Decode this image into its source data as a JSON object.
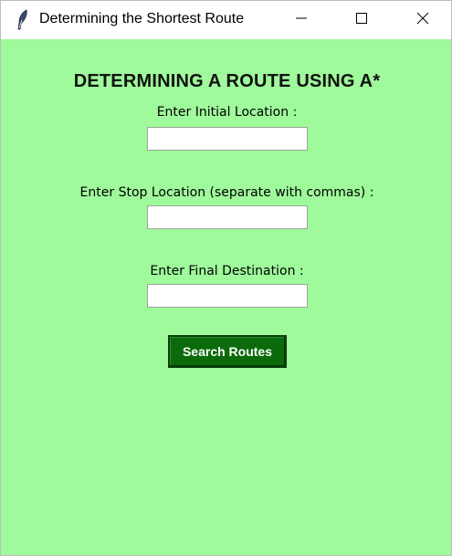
{
  "window": {
    "title": "Determining the Shortest Route",
    "controls": {
      "minimize": "minimize-icon",
      "maximize": "maximize-icon",
      "close": "close-icon"
    },
    "app_icon": "feather-icon"
  },
  "form": {
    "heading": "DETERMINING A ROUTE USING A*",
    "initial_label": "Enter Initial Location :",
    "initial_value": "",
    "stop_label": "Enter Stop Location (separate with commas) :",
    "stop_value": "",
    "final_label": "Enter Final Destination :",
    "final_value": "",
    "search_button": "Search Routes"
  },
  "colors": {
    "background": "#9ffa9b",
    "button": "#0b6b0b",
    "button_text": "#ffffff"
  }
}
